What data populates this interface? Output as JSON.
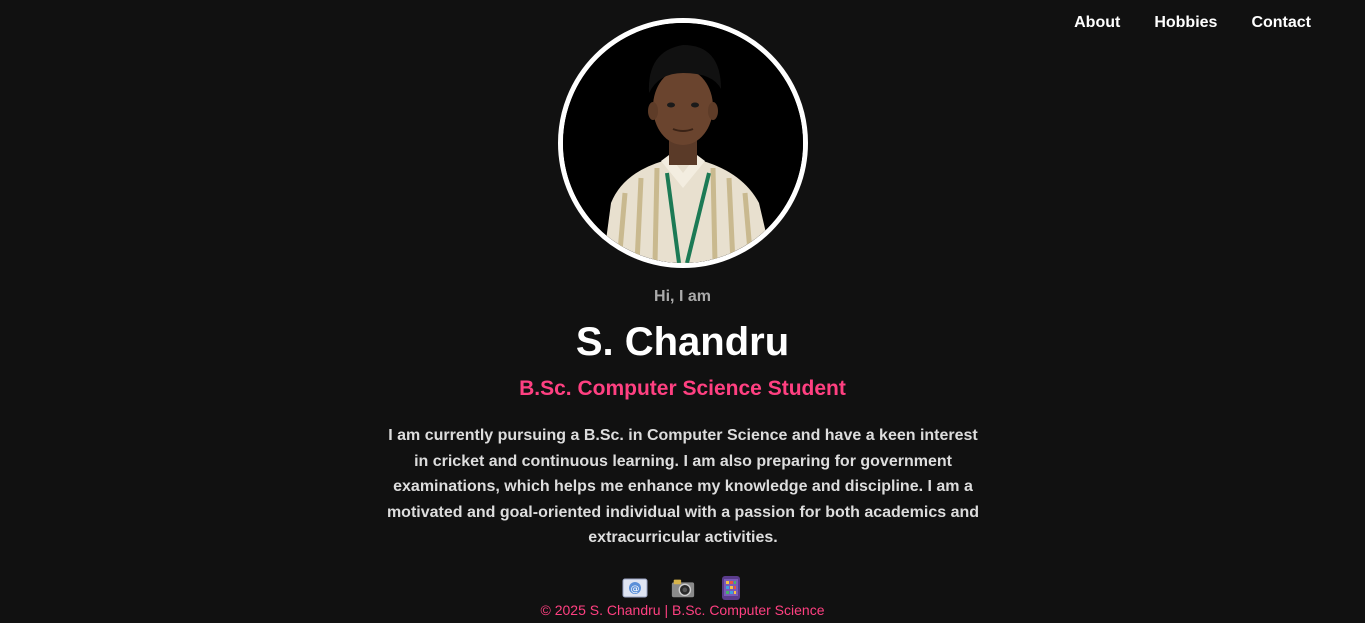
{
  "nav": {
    "items": [
      {
        "label": "About"
      },
      {
        "label": "Hobbies"
      },
      {
        "label": "Contact"
      }
    ]
  },
  "hero": {
    "greeting": "Hi, I am",
    "name": "S. Chandru",
    "role": "B.Sc. Computer Science Student",
    "bio": "I am currently pursuing a B.Sc. in Computer Science and have a keen interest in cricket and continuous learning. I am also preparing for government examinations, which helps me enhance my knowledge and discipline. I am a motivated and goal-oriented individual with a passion for both academics and extracurricular activities."
  },
  "socials": [
    {
      "icon": "email-icon"
    },
    {
      "icon": "camera-icon"
    },
    {
      "icon": "phone-icon"
    }
  ],
  "footer": {
    "text": "© 2025 S. Chandru | B.Sc. Computer Science"
  },
  "colors": {
    "background": "#111111",
    "accent": "#ff4081",
    "text": "#ffffff",
    "muted": "#aaaaaa"
  }
}
